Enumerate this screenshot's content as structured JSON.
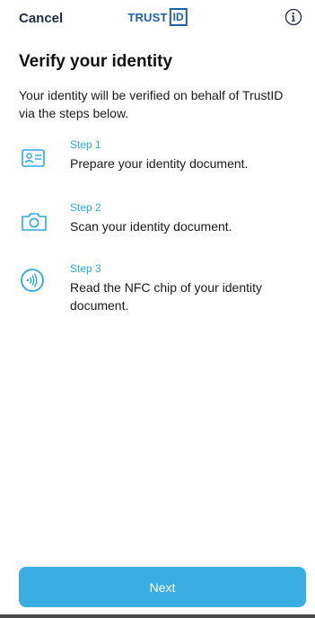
{
  "nav": {
    "cancel_label": "Cancel",
    "logo_text": "TRUST",
    "logo_box_text": "ID"
  },
  "main": {
    "title": "Verify your identity",
    "intro": "Your identity will be verified on behalf of TrustID via the steps below."
  },
  "steps": [
    {
      "label": "Step 1",
      "description": "Prepare your identity document.",
      "icon": "id-card-icon"
    },
    {
      "label": "Step 2",
      "description": "Scan your identity document.",
      "icon": "camera-icon"
    },
    {
      "label": "Step 3",
      "description": "Read the NFC chip of your identity document.",
      "icon": "nfc-icon"
    }
  ],
  "footer": {
    "next_label": "Next"
  },
  "colors": {
    "accent": "#2aa8e0",
    "button": "#3aaee3",
    "logo": "#1e5fae"
  }
}
